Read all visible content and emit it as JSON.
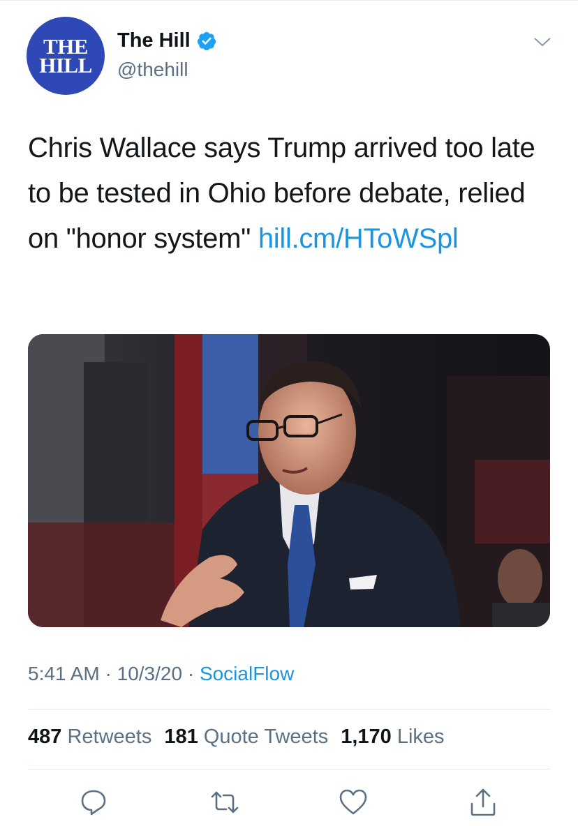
{
  "account": {
    "avatar_line1": "THE",
    "avatar_line2": "HILL",
    "display_name": "The Hill",
    "handle": "@thehill",
    "verified": true
  },
  "tweet": {
    "text": "Chris Wallace says Trump arrived too late to be tested in Ohio before debate, relied on \"honor system\" ",
    "link": "hill.cm/HToWSpl",
    "image_alt": "Photo of a man in a dark suit, blue tie and glasses speaking, with a red and blue backdrop behind him",
    "time": "5:41 AM",
    "date": "10/3/20",
    "separator": "·",
    "source": "SocialFlow"
  },
  "stats": {
    "retweets_count": "487",
    "retweets_label": "Retweets",
    "quotes_count": "181",
    "quotes_label": "Quote Tweets",
    "likes_count": "1,170",
    "likes_label": "Likes"
  },
  "actions": [
    "reply-icon",
    "retweet-icon",
    "like-icon",
    "share-icon"
  ],
  "colors": {
    "link": "#1b95e0",
    "muted": "#5b7083",
    "avatar_bg": "#2e49b6",
    "verified": "#1da1f2"
  }
}
